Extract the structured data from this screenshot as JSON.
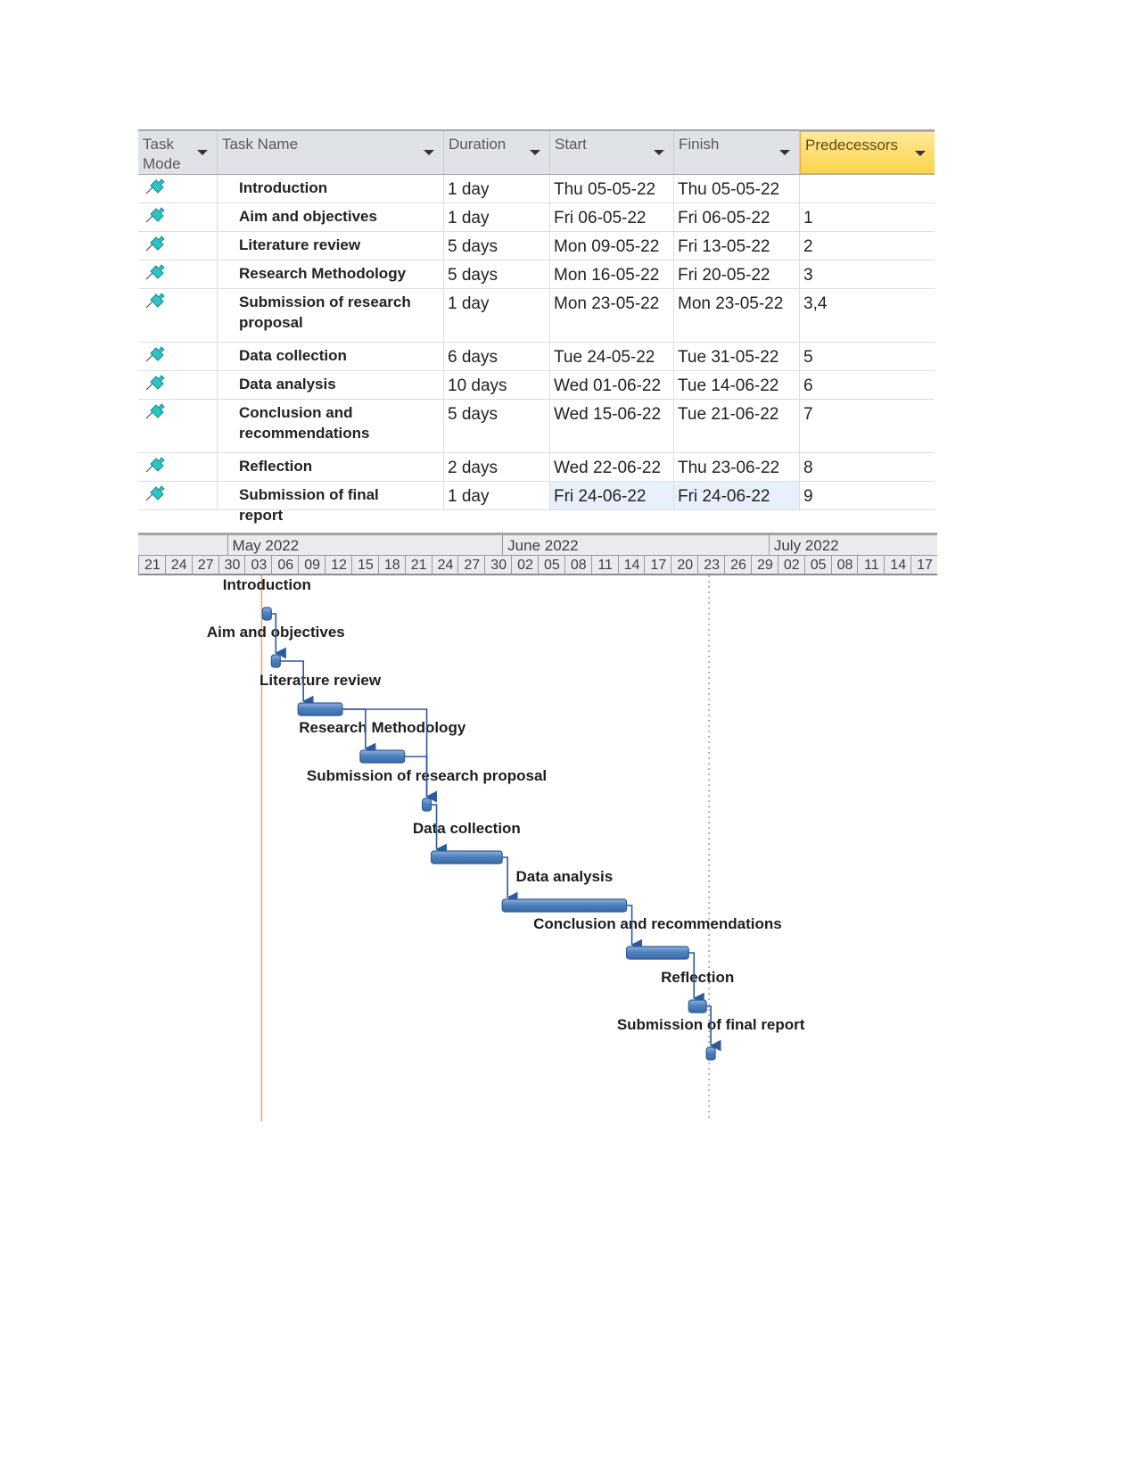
{
  "table": {
    "columns": [
      {
        "key": "mode",
        "label": "Task Mode"
      },
      {
        "key": "name",
        "label": "Task Name"
      },
      {
        "key": "duration",
        "label": "Duration"
      },
      {
        "key": "start",
        "label": "Start"
      },
      {
        "key": "finish",
        "label": "Finish"
      },
      {
        "key": "predecessors",
        "label": "Predecessors",
        "highlighted": true
      }
    ],
    "rows": [
      {
        "mode_icon": "manual-pin-icon",
        "name": "Introduction",
        "duration": "1 day",
        "start": "Thu 05-05-22",
        "finish": "Thu 05-05-22",
        "predecessors": ""
      },
      {
        "mode_icon": "manual-pin-icon",
        "name": "Aim and objectives",
        "duration": "1 day",
        "start": "Fri 06-05-22",
        "finish": "Fri 06-05-22",
        "predecessors": "1"
      },
      {
        "mode_icon": "manual-pin-icon",
        "name": "Literature review",
        "duration": "5 days",
        "start": "Mon 09-05-22",
        "finish": "Fri 13-05-22",
        "predecessors": "2"
      },
      {
        "mode_icon": "manual-pin-icon",
        "name": "Research Methodology",
        "duration": "5 days",
        "start": "Mon 16-05-22",
        "finish": "Fri 20-05-22",
        "predecessors": "3"
      },
      {
        "mode_icon": "manual-pin-icon",
        "name": "Submission of research proposal",
        "duration": "1 day",
        "start": "Mon 23-05-22",
        "finish": "Mon 23-05-22",
        "predecessors": "3,4"
      },
      {
        "mode_icon": "manual-pin-icon",
        "name": "Data collection",
        "duration": "6 days",
        "start": "Tue 24-05-22",
        "finish": "Tue 31-05-22",
        "predecessors": "5"
      },
      {
        "mode_icon": "manual-pin-icon",
        "name": "Data analysis",
        "duration": "10 days",
        "start": "Wed 01-06-22",
        "finish": "Tue 14-06-22",
        "predecessors": "6"
      },
      {
        "mode_icon": "manual-pin-icon",
        "name": "Conclusion and recommendations",
        "duration": "5 days",
        "start": "Wed 15-06-22",
        "finish": "Tue 21-06-22",
        "predecessors": "7"
      },
      {
        "mode_icon": "manual-pin-icon",
        "name": "Reflection",
        "duration": "2 days",
        "start": "Wed 22-06-22",
        "finish": "Thu 23-06-22",
        "predecessors": "8"
      },
      {
        "mode_icon": "manual-pin-icon",
        "name": "Submission of final report",
        "duration": "1 day",
        "start": "Fri 24-06-22",
        "finish": "Fri 24-06-22",
        "predecessors": "9",
        "selected": true
      }
    ]
  },
  "chart_data": {
    "type": "gantt",
    "title": "",
    "timescale": {
      "months": [
        "May 2022",
        "June 2022",
        "July 2022"
      ],
      "day_ticks": [
        "21",
        "24",
        "27",
        "30",
        "03",
        "06",
        "09",
        "12",
        "15",
        "18",
        "21",
        "24",
        "27",
        "30",
        "02",
        "05",
        "08",
        "11",
        "14",
        "17",
        "20",
        "23",
        "26",
        "29",
        "02",
        "05",
        "08",
        "11",
        "14",
        "17"
      ],
      "range": [
        "2022-04-21",
        "2022-07-20"
      ]
    },
    "today_line": "2022-05-05",
    "deadline_line": "2022-06-24",
    "tasks": [
      {
        "id": 1,
        "name": "Introduction",
        "start": "2022-05-05",
        "finish": "2022-05-05",
        "predecessors": []
      },
      {
        "id": 2,
        "name": "Aim and objectives",
        "start": "2022-05-06",
        "finish": "2022-05-06",
        "predecessors": [
          1
        ]
      },
      {
        "id": 3,
        "name": "Literature review",
        "start": "2022-05-09",
        "finish": "2022-05-13",
        "predecessors": [
          2
        ]
      },
      {
        "id": 4,
        "name": "Research Methodology",
        "start": "2022-05-16",
        "finish": "2022-05-20",
        "predecessors": [
          3
        ]
      },
      {
        "id": 5,
        "name": "Submission of research proposal",
        "start": "2022-05-23",
        "finish": "2022-05-23",
        "predecessors": [
          3,
          4
        ]
      },
      {
        "id": 6,
        "name": "Data collection",
        "start": "2022-05-24",
        "finish": "2022-05-31",
        "predecessors": [
          5
        ]
      },
      {
        "id": 7,
        "name": "Data analysis",
        "start": "2022-06-01",
        "finish": "2022-06-14",
        "predecessors": [
          6
        ]
      },
      {
        "id": 8,
        "name": "Conclusion and recommendations",
        "start": "2022-06-15",
        "finish": "2022-06-21",
        "predecessors": [
          7
        ]
      },
      {
        "id": 9,
        "name": "Reflection",
        "start": "2022-06-22",
        "finish": "2022-06-23",
        "predecessors": [
          8
        ]
      },
      {
        "id": 10,
        "name": "Submission of final report",
        "start": "2022-06-24",
        "finish": "2022-06-24",
        "predecessors": [
          9
        ]
      }
    ],
    "colors": {
      "bar": "#4f81bd",
      "bar_dark": "#2f5d95",
      "link": "#2c5a9c",
      "today": "#f0a060",
      "deadline": "#a0a0a0"
    }
  }
}
